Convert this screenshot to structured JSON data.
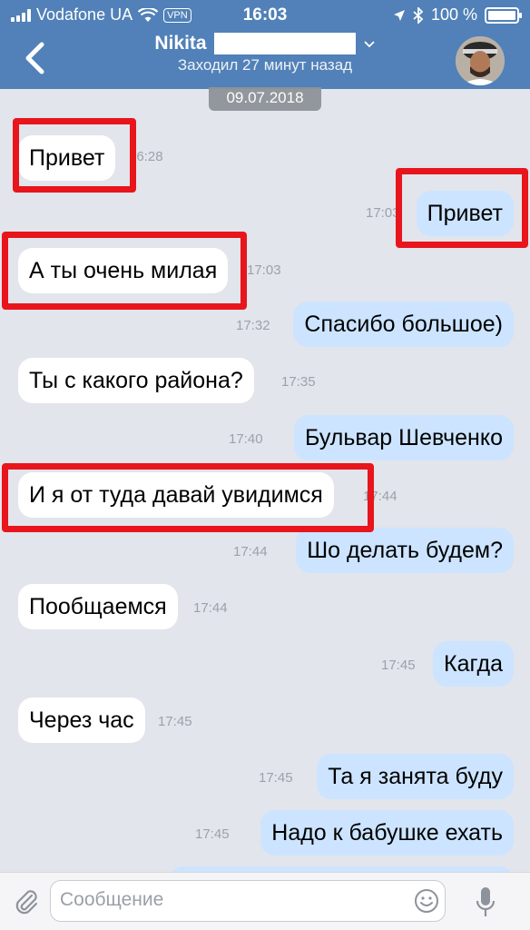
{
  "status_bar": {
    "carrier": "Vodafone UA",
    "vpn_label": "VPN",
    "time": "16:03",
    "battery": "100 %",
    "battery_level": 1.0
  },
  "header": {
    "name": "Nikita",
    "last_seen": "Заходил 27 минут назад",
    "date_chip": "09.07.2018"
  },
  "messages": [
    {
      "dir": "in",
      "text": "Привет",
      "time": "16:28"
    },
    {
      "dir": "out",
      "text": "Привет",
      "time": "17:03"
    },
    {
      "dir": "in",
      "text": "А ты очень милая",
      "time": "17:03"
    },
    {
      "dir": "out",
      "text": "Спасибо большое)",
      "time": "17:32"
    },
    {
      "dir": "in",
      "text": "Ты с какого района?",
      "time": "17:35"
    },
    {
      "dir": "out",
      "text": "Бульвар Шевченко",
      "time": "17:40"
    },
    {
      "dir": "in",
      "text": "И я от туда давай увидимся",
      "time": "17:44"
    },
    {
      "dir": "out",
      "text": "Шо делать будем?",
      "time": "17:44"
    },
    {
      "dir": "in",
      "text": "Пообщаемся",
      "time": "17:44"
    },
    {
      "dir": "out",
      "text": "Кагда",
      "time": "17:45"
    },
    {
      "dir": "in",
      "text": "Через час",
      "time": "17:45"
    },
    {
      "dir": "out",
      "text": "Та я занята буду",
      "time": "17:45"
    },
    {
      "dir": "out",
      "text": "Надо к бабушке ехать",
      "time": "17:45"
    }
  ],
  "composer": {
    "placeholder": "Сообщение"
  },
  "colors": {
    "header": "#5181b8",
    "outgoing_bubble": "#cce4ff",
    "incoming_bubble": "#ffffff",
    "highlight": "#e8151c"
  }
}
